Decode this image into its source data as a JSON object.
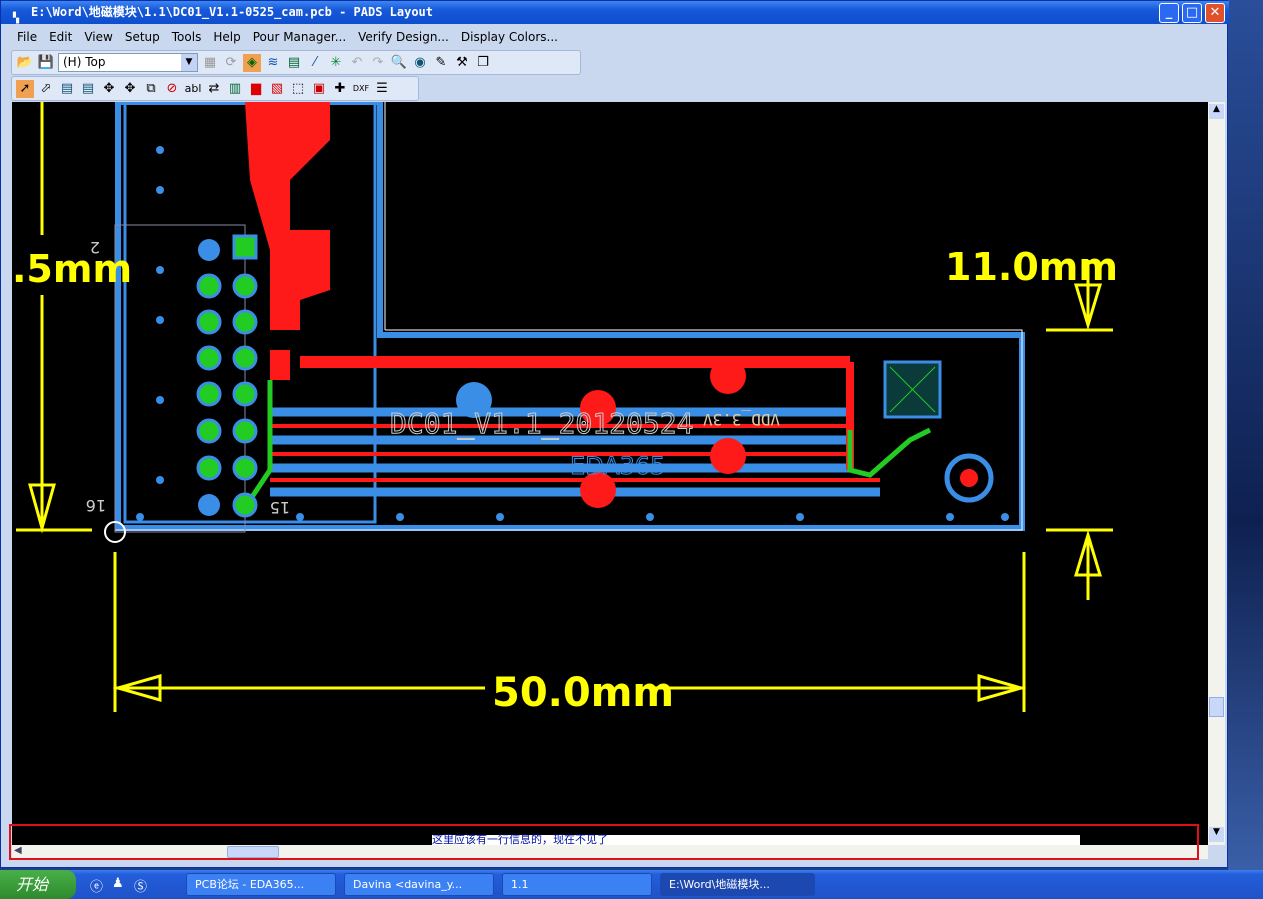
{
  "window": {
    "title": "E:\\Word\\地磁模块\\1.1\\DC01_V1.1-0525_cam.pcb - PADS Layout"
  },
  "menu": [
    "File",
    "Edit",
    "View",
    "Setup",
    "Tools",
    "Help",
    "Pour Manager...",
    "Verify Design...",
    "Display Colors..."
  ],
  "toolbar": {
    "layer_select": "(H) Top"
  },
  "pcb": {
    "dim_height_left": ".5mm",
    "dim_height_right": "11.0mm",
    "dim_width": "50.0mm",
    "silk_board_name": "DC01_V1.1_20120524",
    "silk_logo": "EDA365",
    "silk_net": "VDD_3.3V",
    "pin_16": "16",
    "pin_15": "15",
    "pin_2": "2",
    "colors": {
      "copper_top": "#ff1a1a",
      "copper_bottom": "#3a8ee6",
      "dimension": "#ffff00",
      "silk": "#d0d0d0",
      "pad_green": "#22cc22"
    }
  },
  "status": {
    "message": "这里应该有一行信息的，现在不见了"
  },
  "taskbar": {
    "start": "开始",
    "items": [
      "PCB论坛 - EDA365...",
      "Davina <davina_y...",
      "1.1",
      "E:\\Word\\地磁模块..."
    ]
  }
}
